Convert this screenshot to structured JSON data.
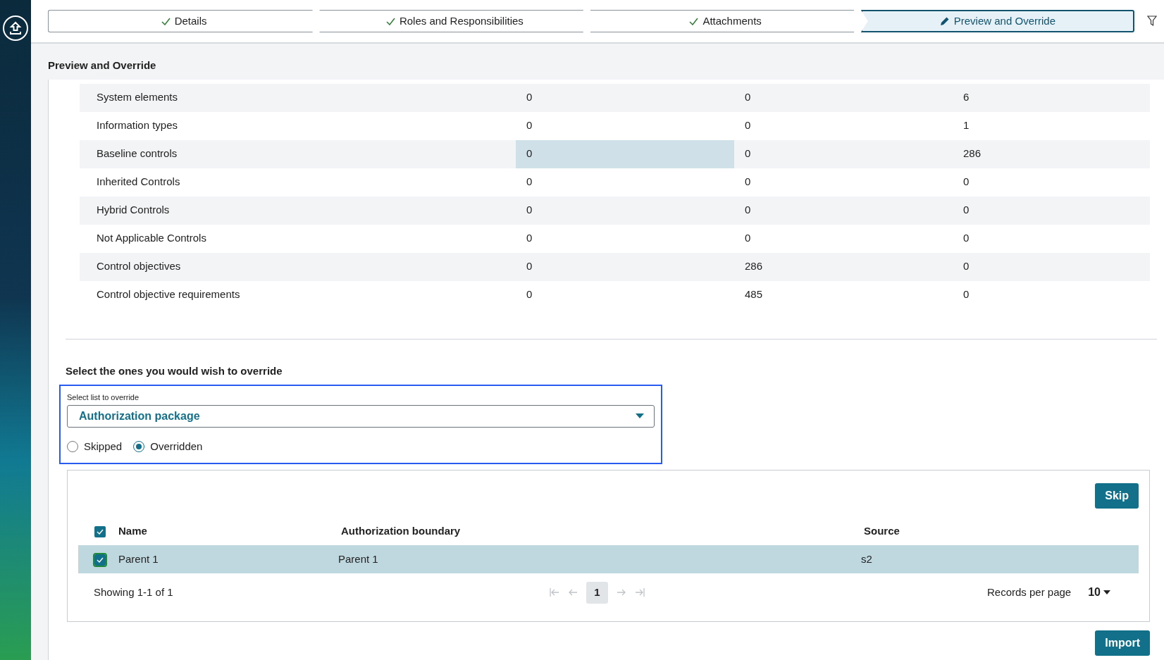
{
  "steps": [
    {
      "label": "Details",
      "kind": "done",
      "selected": false
    },
    {
      "label": "Roles and Responsibilities",
      "kind": "done",
      "selected": false
    },
    {
      "label": "Attachments",
      "kind": "done",
      "selected": false
    },
    {
      "label": "Preview and Override",
      "kind": "edit",
      "selected": true
    }
  ],
  "section_title": "Preview and Override",
  "summary_rows": [
    {
      "label": "System elements",
      "values": [
        "0",
        "0",
        "6"
      ],
      "highlighted": [
        false,
        false,
        false
      ]
    },
    {
      "label": "Information types",
      "values": [
        "0",
        "0",
        "1"
      ],
      "highlighted": [
        false,
        false,
        false
      ]
    },
    {
      "label": "Baseline controls",
      "values": [
        "0",
        "0",
        "286"
      ],
      "highlighted": [
        true,
        false,
        false
      ]
    },
    {
      "label": "Inherited Controls",
      "values": [
        "0",
        "0",
        "0"
      ],
      "highlighted": [
        false,
        false,
        false
      ]
    },
    {
      "label": "Hybrid Controls",
      "values": [
        "0",
        "0",
        "0"
      ],
      "highlighted": [
        false,
        false,
        false
      ]
    },
    {
      "label": "Not Applicable Controls",
      "values": [
        "0",
        "0",
        "0"
      ],
      "highlighted": [
        false,
        false,
        false
      ]
    },
    {
      "label": "Control objectives",
      "values": [
        "0",
        "286",
        "0"
      ],
      "highlighted": [
        false,
        false,
        false
      ]
    },
    {
      "label": "Control objective requirements",
      "values": [
        "0",
        "485",
        "0"
      ],
      "highlighted": [
        false,
        false,
        false
      ]
    }
  ],
  "override": {
    "heading": "Select the ones you would wish to override",
    "select_label": "Select list to override",
    "select_value": "Authorization package",
    "options": [
      {
        "label": "Skipped",
        "selected": false
      },
      {
        "label": "Overridden",
        "selected": true
      }
    ]
  },
  "skip_button": "Skip",
  "table": {
    "columns": [
      "Name",
      "Authorization boundary",
      "Source"
    ],
    "all_checked": true,
    "rows": [
      {
        "cells": [
          "Parent 1",
          "Parent 1",
          "s2"
        ],
        "checked": true,
        "selected": true
      }
    ]
  },
  "pagination": {
    "showing": "Showing 1-1 of 1",
    "page": "1",
    "records_label": "Records per page",
    "records_value": "10"
  },
  "import_button": "Import"
}
